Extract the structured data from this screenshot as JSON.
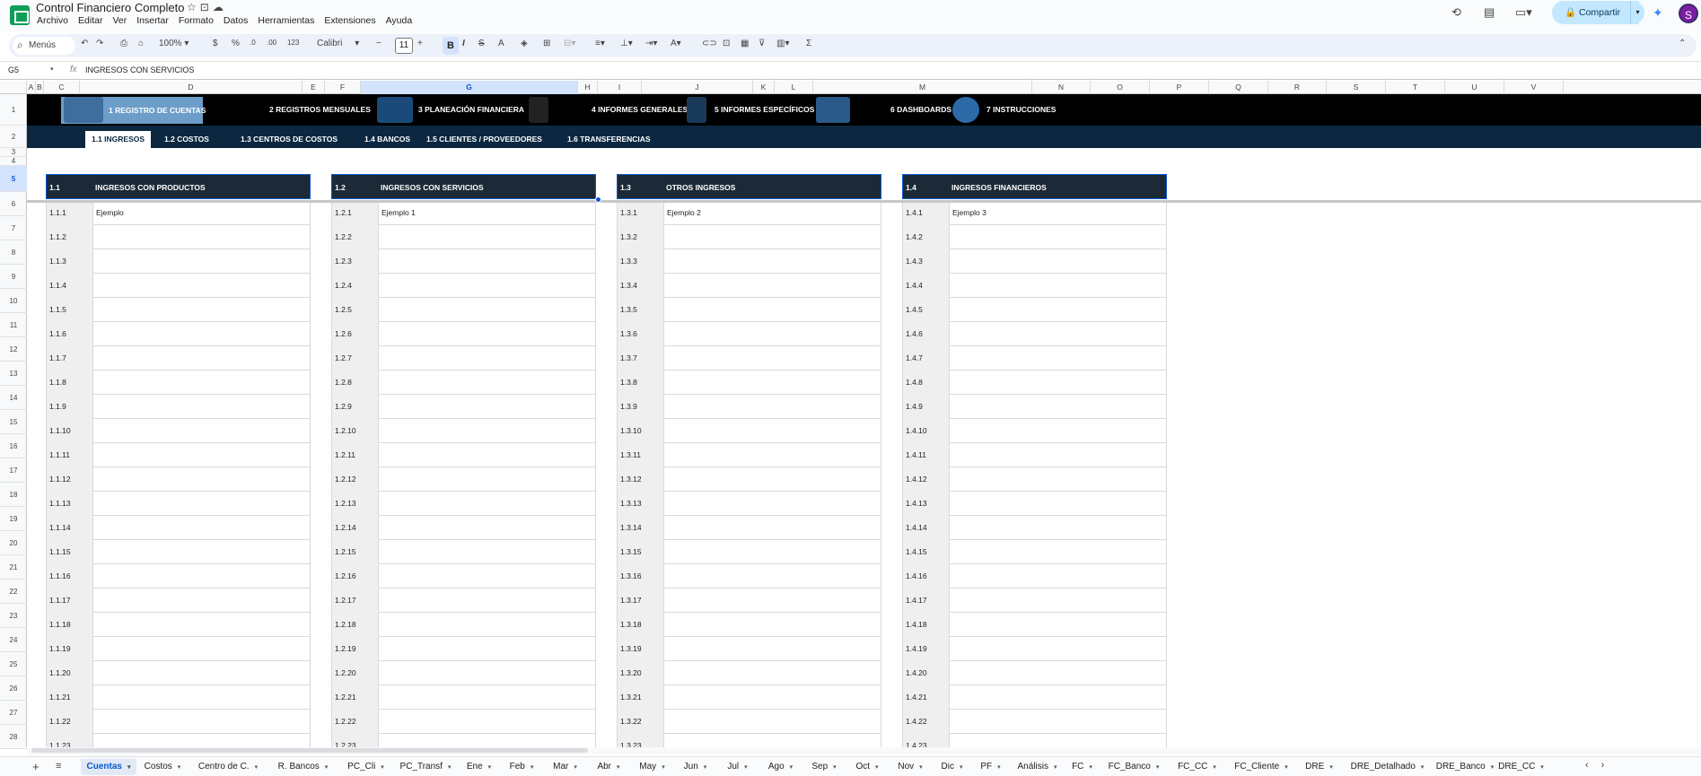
{
  "app": {
    "title": "Control Financiero Completo",
    "menus": [
      "Archivo",
      "Editar",
      "Ver",
      "Insertar",
      "Formato",
      "Datos",
      "Herramientas",
      "Extensiones",
      "Ayuda"
    ],
    "share_label": "Compartir",
    "avatar_letter": "S"
  },
  "toolbar": {
    "menus_search": "Menús",
    "zoom": "100%",
    "currency": "$",
    "percent": "%",
    "dec_decrease": ".0",
    "dec_increase": ".00",
    "number_format": "123",
    "font": "Calibri",
    "font_size": "11",
    "bold": "B",
    "italic": "I",
    "strike": "S",
    "text_color": "A",
    "sum": "Σ"
  },
  "formula_bar": {
    "cell_ref": "G5",
    "fx": "fx",
    "content": "INGRESOS CON SERVICIOS"
  },
  "columns": [
    "A",
    "B",
    "C",
    "D",
    "E",
    "F",
    "G",
    "H",
    "I",
    "J",
    "K",
    "L",
    "M",
    "N",
    "O",
    "P",
    "Q",
    "R",
    "S",
    "T",
    "U",
    "V"
  ],
  "selected_column": "G",
  "rows": [
    "1",
    "2",
    "3",
    "4",
    "5",
    "6",
    "7",
    "8",
    "9",
    "10",
    "11",
    "12",
    "13",
    "14",
    "15",
    "16",
    "17",
    "18",
    "19",
    "20",
    "21",
    "22",
    "23",
    "24",
    "25",
    "26",
    "27",
    "28"
  ],
  "selected_row": "5",
  "nav": {
    "items": [
      "1 REGISTRO DE CUENTAS",
      "2 REGISTROS MENSUALES",
      "3 PLANEACIÓN FINANCIERA",
      "4 INFORMES GENERALES",
      "5 INFORMES ESPECÍFICOS",
      "6 DASHBOARDS",
      "7 INSTRUCCIONES"
    ],
    "sub_items": [
      "1.1 INGRESOS",
      "1.2 COSTOS",
      "1.3 CENTROS DE COSTOS",
      "1.4 BANCOS",
      "1.5 CLIENTES / PROVEEDORES",
      "1.6 TRANSFERENCIAS"
    ]
  },
  "blocks": [
    {
      "code": "1.1",
      "title": "INGRESOS CON PRODUCTOS",
      "prefix": "1.1.",
      "first_value": "Ejemplo"
    },
    {
      "code": "1.2",
      "title": "INGRESOS CON SERVICIOS",
      "prefix": "1.2.",
      "first_value": "Ejemplo 1"
    },
    {
      "code": "1.3",
      "title": "OTROS INGRESOS",
      "prefix": "1.3.",
      "first_value": "Ejemplo 2"
    },
    {
      "code": "1.4",
      "title": "INGRESOS FINANCIEROS",
      "prefix": "1.4.",
      "first_value": "Ejemplo 3"
    }
  ],
  "sheet_tabs": [
    "Cuentas",
    "Costos",
    "Centro de C.",
    "R. Bancos",
    "PC_Cli",
    "PC_Transf",
    "Ene",
    "Feb",
    "Mar",
    "Abr",
    "May",
    "Jun",
    "Jul",
    "Ago",
    "Sep",
    "Oct",
    "Nov",
    "Dic",
    "PF",
    "Análisis",
    "FC",
    "FC_Banco",
    "FC_CC",
    "FC_Cliente",
    "DRE",
    "DRE_Detalhado",
    "DRE_Banco",
    "DRE_CC"
  ],
  "active_sheet": "Cuentas"
}
